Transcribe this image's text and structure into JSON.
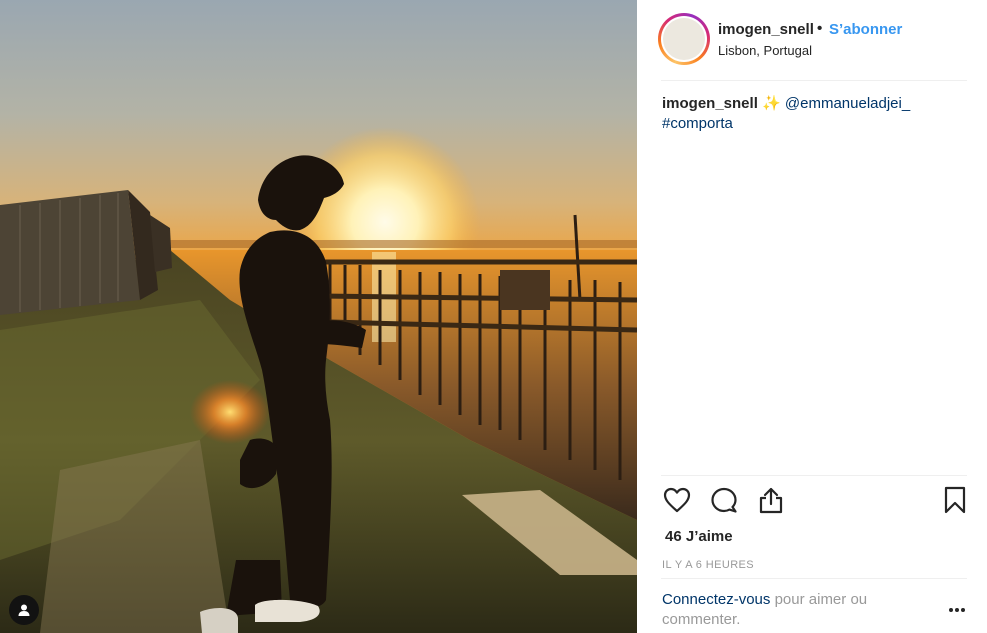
{
  "post": {
    "username": "imogen_snell",
    "separator": "•",
    "follow_label": "S’abonner",
    "location": "Lisbon, Portugal",
    "caption": {
      "username": "imogen_snell",
      "emoji": "✨",
      "mention": "@emmanueladjei_",
      "hashtag": "#comporta"
    },
    "likes": "46 J’aime",
    "timestamp": "IL Y A 6 HEURES",
    "login_prompt": {
      "link_text": "Connectez-vous",
      "rest_text": " pour aimer ou commenter."
    }
  },
  "icons": {
    "like": "heart-outline-icon",
    "comment": "comment-bubble-icon",
    "share": "share-upload-icon",
    "save": "bookmark-icon",
    "more": "more-options-icon",
    "user_tags": "user-tag-icon"
  },
  "colors": {
    "follow": "#3897f0",
    "link": "#003569",
    "muted": "#999999",
    "text": "#262626"
  }
}
